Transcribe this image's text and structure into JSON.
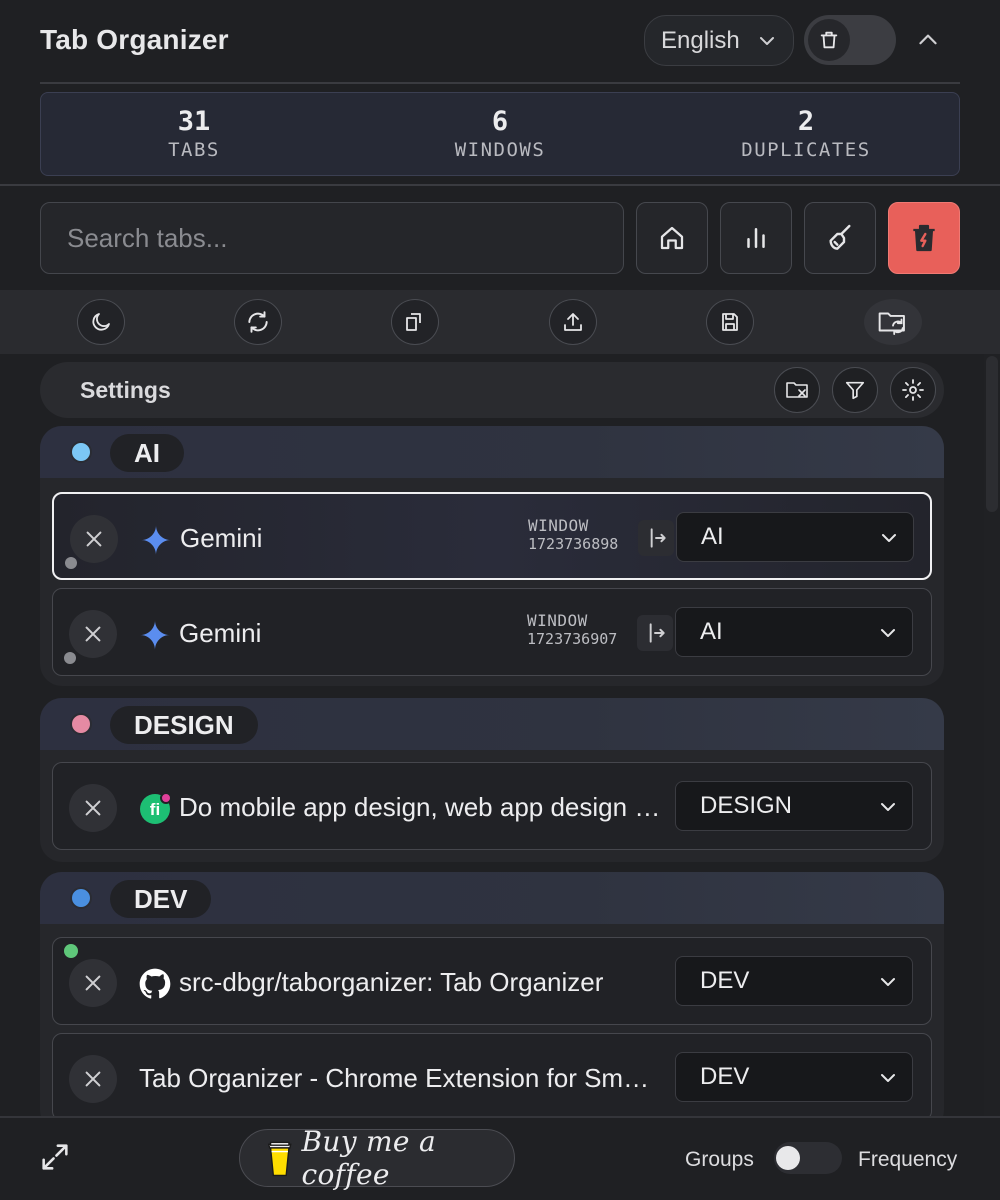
{
  "header": {
    "title": "Tab Organizer",
    "language": "English"
  },
  "stats": [
    {
      "value": "31",
      "label": "TABS"
    },
    {
      "value": "6",
      "label": "WINDOWS"
    },
    {
      "value": "2",
      "label": "DUPLICATES"
    }
  ],
  "search": {
    "placeholder": "Search tabs..."
  },
  "toolbar_icons": [
    "home-icon",
    "bar-chart-icon",
    "broom-icon",
    "trash-bolt-icon"
  ],
  "action_icons": [
    "moon-icon",
    "refresh-icon",
    "copy-icon",
    "upload-icon",
    "save-icon",
    "folder-sync-icon"
  ],
  "settings": {
    "label": "Settings",
    "icons": [
      "folder-x-icon",
      "filter-icon",
      "gear-icon"
    ]
  },
  "groups": [
    {
      "name": "AI",
      "color": "#7cc7f5",
      "tabs": [
        {
          "title": "Gemini",
          "favicon": "gemini-icon",
          "window_label": "WINDOW",
          "window_id": "1723736898",
          "group": "AI",
          "active": true
        },
        {
          "title": "Gemini",
          "favicon": "gemini-icon",
          "window_label": "WINDOW",
          "window_id": "1723736907",
          "group": "AI",
          "active": false
        }
      ]
    },
    {
      "name": "DESIGN",
      "color": "#e58aa3",
      "tabs": [
        {
          "title": "Do mobile app design, web app design and ui ux design by Creatoroftru | Fiverr",
          "favicon": "fiverr-icon",
          "group": "DESIGN"
        }
      ]
    },
    {
      "name": "DEV",
      "color": "#4a8fe0",
      "tabs": [
        {
          "title": "src-dbgr/taborganizer: Tab Organizer",
          "favicon": "github-icon",
          "group": "DEV"
        },
        {
          "title": "Tab Organizer - Chrome Extension for Smart Tab Management",
          "favicon": "",
          "group": "DEV"
        }
      ]
    }
  ],
  "footer": {
    "coffee_label": "Buy me a coffee",
    "toggle_left": "Groups",
    "toggle_right": "Frequency"
  },
  "colors": {
    "danger": "#e8605a",
    "status_green": "#5fc77a",
    "status_gray": "#8a8b90"
  }
}
